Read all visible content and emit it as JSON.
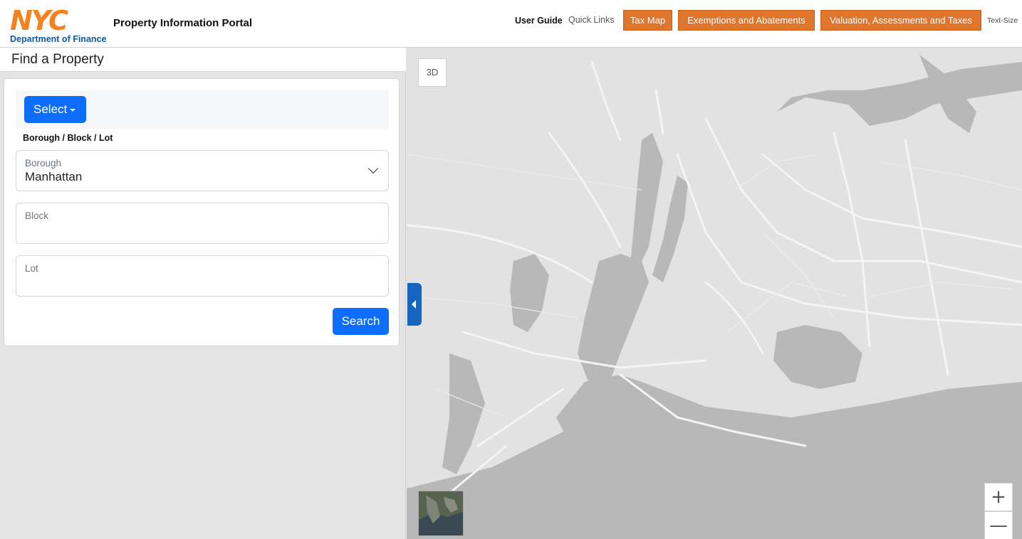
{
  "header": {
    "logo_text": "NYC",
    "logo_subtitle": "Department of Finance",
    "portal_title": "Property Information Portal",
    "user_guide": "User Guide",
    "quick_links": "Quick Links",
    "tax_map": "Tax Map",
    "exemptions": "Exemptions and Abatements",
    "valuation": "Valuation, Assessments and Taxes",
    "text_size": "Text-Size"
  },
  "panel": {
    "title": "Find a Property",
    "select_label": "Select",
    "mode_label": "Borough / Block / Lot",
    "borough": {
      "label": "Borough",
      "value": "Manhattan"
    },
    "block": {
      "label": "Block",
      "value": ""
    },
    "lot": {
      "label": "Lot",
      "value": ""
    },
    "search_label": "Search"
  },
  "map": {
    "btn_3d": "3D",
    "zoom_in": "+",
    "zoom_out": "—",
    "collapse_icon": "caret-left-icon",
    "basemap_icon": "satellite-basemap-icon"
  },
  "colors": {
    "accent_orange": "#e0752c",
    "primary_blue": "#0d6efd",
    "nyc_orange": "#f5821f",
    "dof_blue": "#0f5aa0",
    "water": "#b8b8b8",
    "land": "#e2e2e2"
  }
}
